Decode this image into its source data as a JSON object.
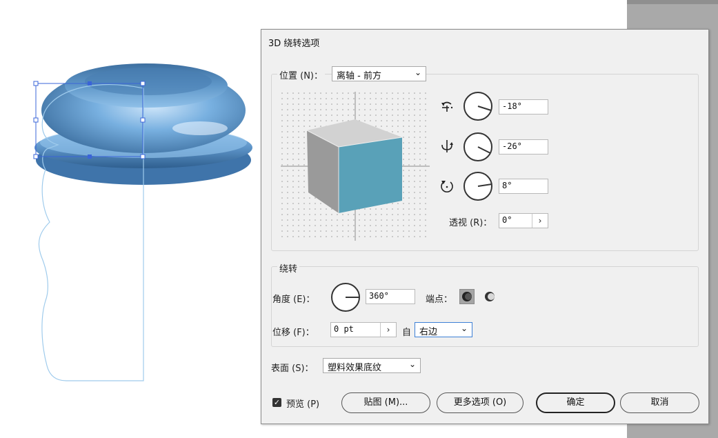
{
  "dialog": {
    "title": "3D 绕转选项",
    "position": {
      "label": "位置 (N)：",
      "selected": "离轴 - 前方",
      "x_rotation": "-18°",
      "y_rotation": "-26°",
      "z_rotation": "8°",
      "perspective_label": "透视 (R)：",
      "perspective_value": "0°"
    },
    "revolve": {
      "legend": "绕转",
      "angle_label": "角度 (E)：",
      "angle_value": "360°",
      "cap_label": "端点：",
      "offset_label": "位移 (F)：",
      "offset_value": "0 pt",
      "from_label": "自",
      "from_selected": "右边"
    },
    "surface": {
      "label": "表面 (S)：",
      "selected": "塑料效果底纹"
    },
    "footer": {
      "preview_label": "预览 (P)",
      "preview_checked": true,
      "map_art_button": "贴图 (M)...",
      "more_options_button": "更多选项 (O)",
      "ok_button": "确定",
      "cancel_button": "取消"
    }
  },
  "colors": {
    "cube_front": "#59a1b8",
    "cube_top": "#d2d2d2",
    "cube_side": "#9a9a9a",
    "selection_blue": "#3a64d8",
    "object_blue": "#5b9bd5"
  },
  "icons": [
    "rotate-x-axis-icon",
    "rotate-y-axis-icon",
    "rotate-z-axis-icon",
    "angle-dial-icon",
    "cap-on-icon",
    "cap-off-icon",
    "checkmark-icon",
    "chevron-down-icon",
    "chevron-right-icon"
  ]
}
